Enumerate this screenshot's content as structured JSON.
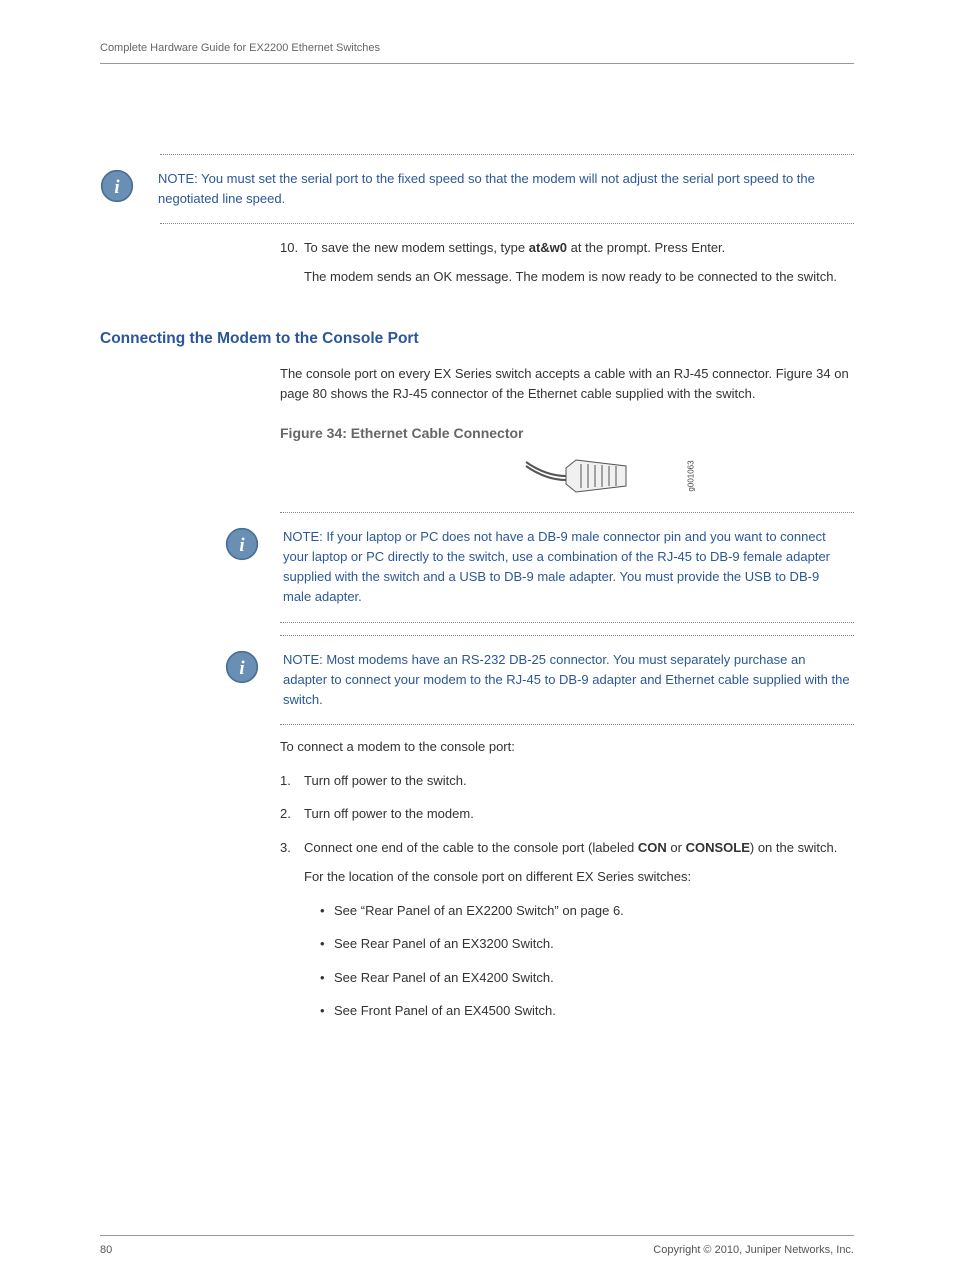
{
  "header": {
    "running_title": "Complete Hardware Guide for EX2200 Ethernet Switches"
  },
  "notes": {
    "note1_label": "NOTE:",
    "note1_text": " You must set the serial port to the fixed speed so that the modem will not adjust the serial port speed to the negotiated line speed.",
    "note2_label": "NOTE:",
    "note2_text": " If your laptop or PC does not have a DB-9 male connector pin and you want to connect your laptop or PC directly to the switch, use a combination of the RJ-45 to DB-9 female adapter supplied with the switch and a USB to DB-9 male adapter. You must provide the USB to DB-9 male adapter.",
    "note3_label": "NOTE:",
    "note3_text": " Most modems have an RS-232 DB-25 connector. You must separately purchase an adapter to connect your modem to the RJ-45 to DB-9 adapter and Ethernet cable supplied with the switch."
  },
  "step10": {
    "num": "10.",
    "text_before": "To save the new modem settings, type ",
    "cmd": "at&w0",
    "text_after": " at the prompt. Press Enter.",
    "result": "The modem sends an OK message. The modem is now ready to be connected to the switch."
  },
  "section": {
    "title": "Connecting the Modem to the Console Port",
    "intro": "The console port on every EX Series switch accepts a cable with an RJ-45 connector. Figure 34 on page 80 shows the RJ-45 connector of the Ethernet cable supplied with the switch.",
    "figure_title": "Figure 34: Ethernet Cable Connector",
    "figure_code": "g001063",
    "lead_in": "To connect a modem to the console port:",
    "steps": [
      {
        "num": "1.",
        "text": "Turn off power to the switch."
      },
      {
        "num": "2.",
        "text": "Turn off power to the modem."
      }
    ],
    "step3": {
      "num": "3.",
      "before": "Connect one end of the cable to the console port (labeled ",
      "b1": "CON",
      "mid": " or ",
      "b2": "CONSOLE",
      "after": ") on the switch.",
      "sub": "For the location of the console port on different EX Series switches:",
      "bullets": [
        "See “Rear Panel of an EX2200 Switch” on page 6.",
        "See Rear Panel of an EX3200 Switch.",
        "See Rear Panel of an EX4200 Switch.",
        "See Front Panel of an EX4500 Switch."
      ]
    }
  },
  "footer": {
    "page": "80",
    "copyright": "Copyright © 2010, Juniper Networks, Inc."
  }
}
